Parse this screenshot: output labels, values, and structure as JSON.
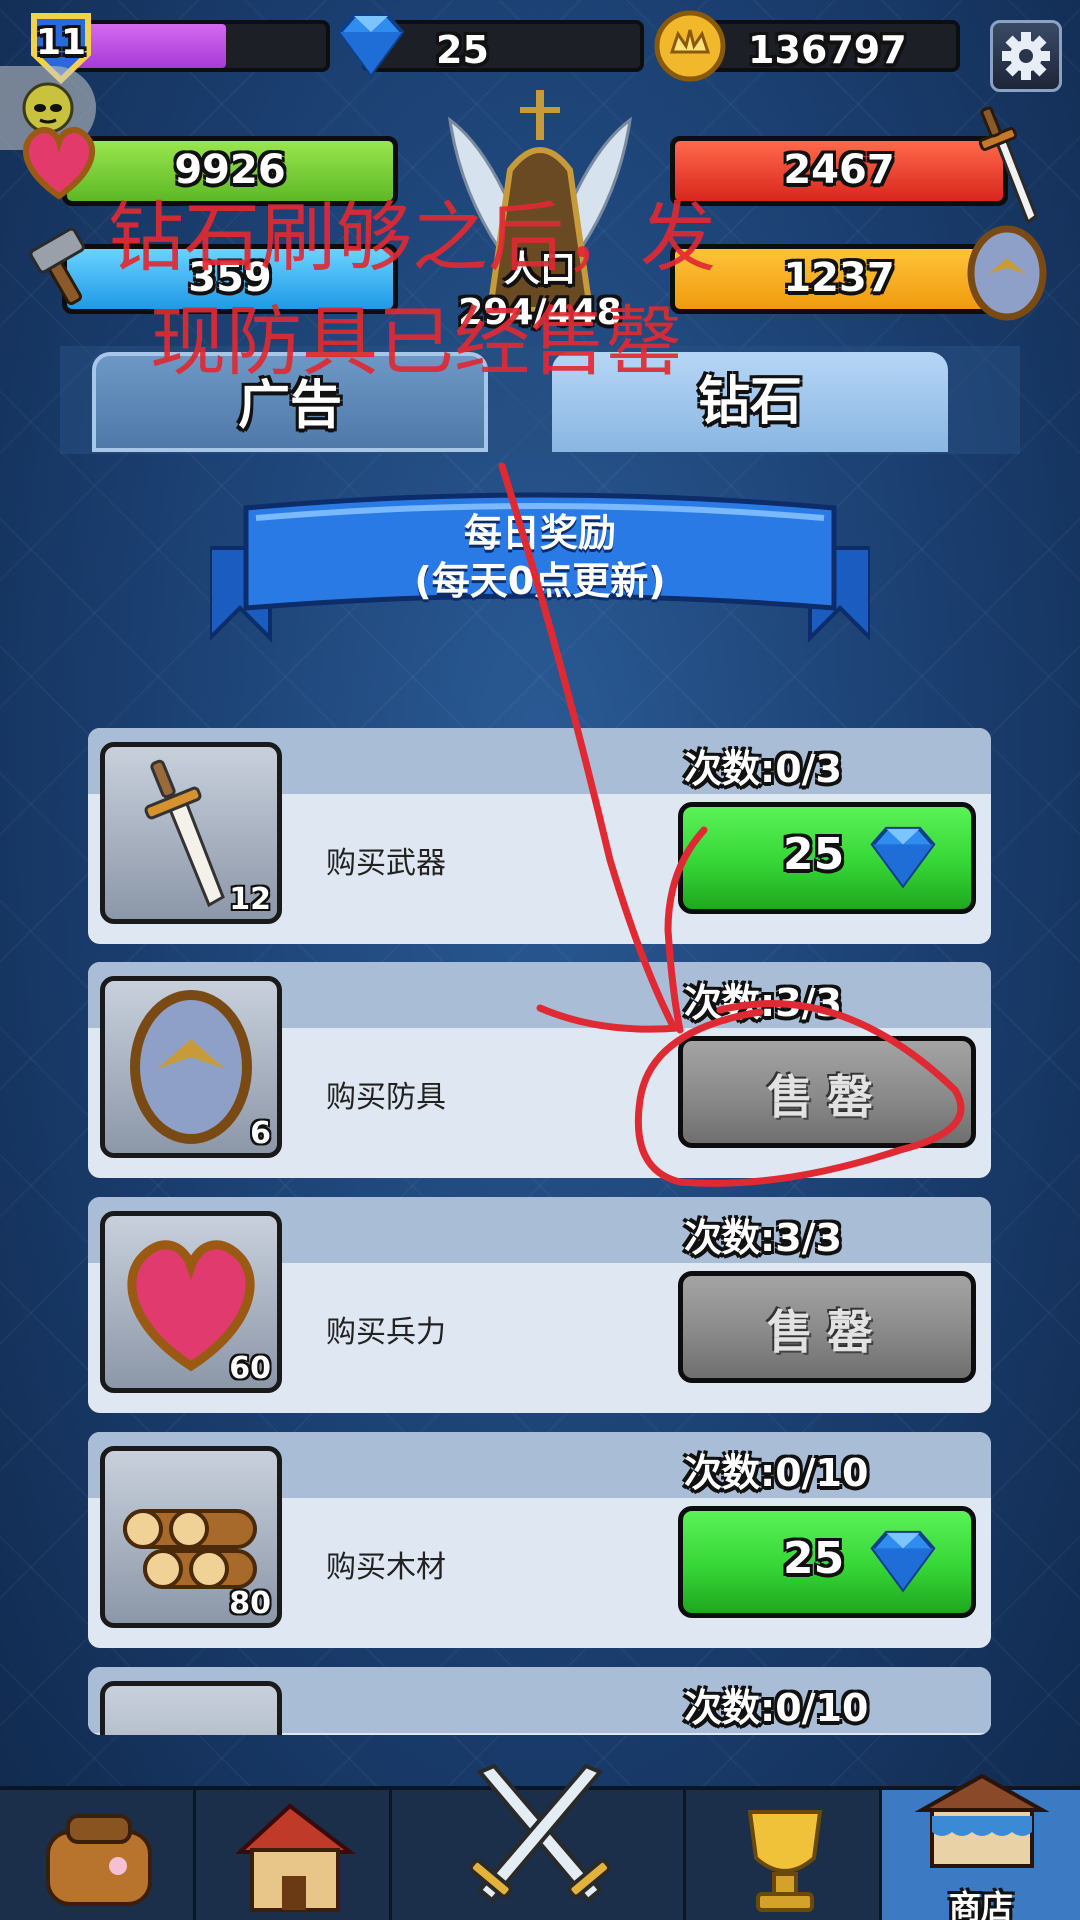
{
  "hud": {
    "level": "11",
    "xp_progress": 0.62,
    "gems": "25",
    "coins": "136797",
    "settings_icon": "gear-icon"
  },
  "stats": {
    "troops": "9926",
    "attack": "2467",
    "building": "359",
    "defense": "1237",
    "population_label": "人口",
    "population_value": "294/448"
  },
  "tabs": [
    {
      "label": "广告",
      "active": false
    },
    {
      "label": "钻石",
      "active": true
    }
  ],
  "banner": {
    "line1": "每日奖励",
    "line2": "(每天0点更新)"
  },
  "rewards": [
    {
      "name": "购买武器",
      "icon": "sword-icon",
      "qty": "12",
      "count": "次数:0/3",
      "button": "price",
      "price": "25"
    },
    {
      "name": "购买防具",
      "icon": "shield-icon",
      "qty": "6",
      "count": "次数:3/3",
      "button": "sold",
      "sold_label": "售罄"
    },
    {
      "name": "购买兵力",
      "icon": "heart-icon",
      "qty": "60",
      "count": "次数:3/3",
      "button": "sold",
      "sold_label": "售罄"
    },
    {
      "name": "购买木材",
      "icon": "logs-icon",
      "qty": "80",
      "count": "次数:0/10",
      "button": "price",
      "price": "25"
    },
    {
      "count": "次数:0/10"
    }
  ],
  "nav": {
    "shop_label": "商店",
    "items": [
      "backpack-icon",
      "house-icon",
      "crossed-swords-icon",
      "trophy-icon",
      "shop-icon"
    ]
  },
  "annotation": {
    "line1": "钻石刷够之后，发",
    "line2": "现防具已经售罄"
  },
  "colors": {
    "green_button": "#36d636",
    "gray_button": "#8a8a8a",
    "annotation_red": "#e02a33",
    "tab_active": "#9fc4ea",
    "tab_inactive": "#5f8ab7"
  }
}
